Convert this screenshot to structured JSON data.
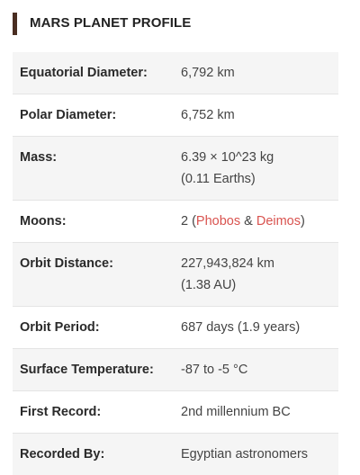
{
  "header": {
    "title": "MARS PLANET PROFILE",
    "accent_color": "#4a2e22"
  },
  "rows": [
    {
      "label": "Equatorial Diameter:",
      "value": "6,792 km"
    },
    {
      "label": "Polar Diameter:",
      "value": "6,752 km"
    },
    {
      "label": "Mass:",
      "value_line1": "6.39 × 10^23 kg",
      "value_line2": "(0.11 Earths)"
    },
    {
      "label": "Moons:",
      "moons_prefix": "2 (",
      "moon1": "Phobos",
      "moons_sep": " & ",
      "moon2": "Deimos",
      "moons_suffix": ")"
    },
    {
      "label": "Orbit Distance:",
      "value_line1": "227,943,824 km",
      "value_line2": "(1.38 AU)"
    },
    {
      "label": "Orbit Period:",
      "value": "687 days (1.9 years)"
    },
    {
      "label": "Surface Temperature:",
      "value": "-87 to -5 °C"
    },
    {
      "label": "First Record:",
      "value": "2nd millennium BC"
    },
    {
      "label": "Recorded By:",
      "value": "Egyptian astronomers"
    }
  ],
  "colors": {
    "link": "#d9534f",
    "stripe": "#f5f5f5"
  }
}
